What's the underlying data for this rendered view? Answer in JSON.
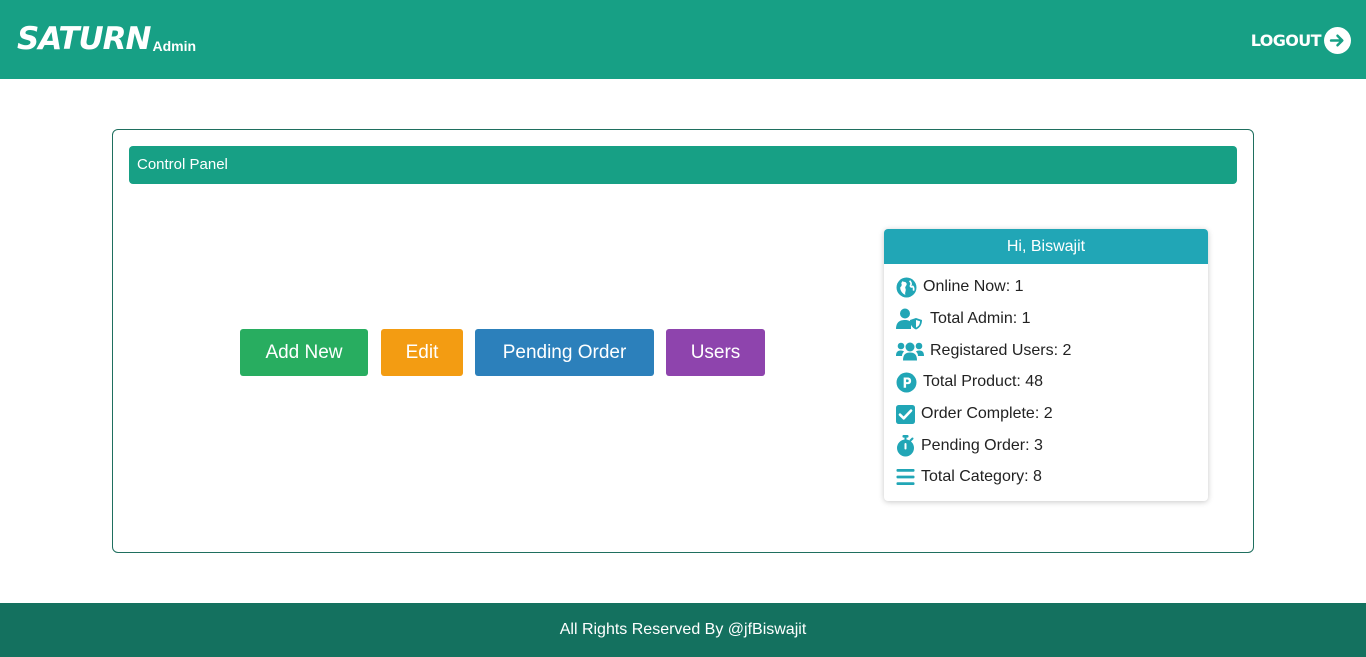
{
  "navbar": {
    "brand": "SATURN",
    "brand_sub": "Admin",
    "logout_label": "LOGOUT",
    "logout_icon": "arrow-right-circle-icon"
  },
  "panel": {
    "title": "Control Panel",
    "buttons": [
      {
        "label": "Add New",
        "color": "#28ad60"
      },
      {
        "label": "Edit",
        "color": "#f39c12"
      },
      {
        "label": "Pending Order",
        "color": "#2c80bb"
      },
      {
        "label": "Users",
        "color": "#8e44ad"
      }
    ]
  },
  "summary": {
    "greeting": "Hi, Biswajit",
    "stats": [
      {
        "label": "Online Now: 1",
        "icon": "globe-icon"
      },
      {
        "label": "Total Admin: 1",
        "icon": "user-shield-icon"
      },
      {
        "label": "Registared Users: 2",
        "icon": "users-icon"
      },
      {
        "label": "Total Product: 48",
        "icon": "product-p-icon"
      },
      {
        "label": "Order Complete: 2",
        "icon": "check-square-icon"
      },
      {
        "label": "Pending Order: 3",
        "icon": "stopwatch-icon"
      },
      {
        "label": "Total Category: 8",
        "icon": "bars-icon"
      }
    ]
  },
  "footer": {
    "text": "All Rights Reserved By @jfBiswajit"
  },
  "colors": {
    "primary": "#17a085",
    "info": "#21a6b6",
    "footer": "#14715f"
  }
}
